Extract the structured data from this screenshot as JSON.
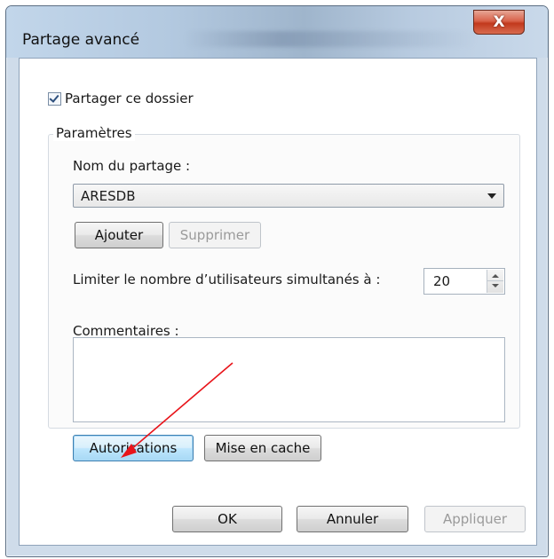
{
  "window": {
    "title": "Partage avancé",
    "close_label": "X"
  },
  "share_checkbox": {
    "label": "Partager ce dossier",
    "checked": true
  },
  "settings_group": {
    "legend": "Paramètres",
    "share_name_label": "Nom du partage :",
    "share_name_value": "ARESDB",
    "add_button": "Ajouter",
    "remove_button": "Supprimer",
    "limit_label": "Limiter le nombre d’utilisateurs simultanés à :",
    "limit_value": "20",
    "comments_label": "Commentaires :",
    "comments_value": "",
    "permissions_button": "Autorisations",
    "caching_button": "Mise en cache"
  },
  "footer": {
    "ok_button": "OK",
    "cancel_button": "Annuler",
    "apply_button": "Appliquer"
  },
  "colors": {
    "annotation_arrow": "#e8141a",
    "focus_border": "#3c7fb1"
  }
}
